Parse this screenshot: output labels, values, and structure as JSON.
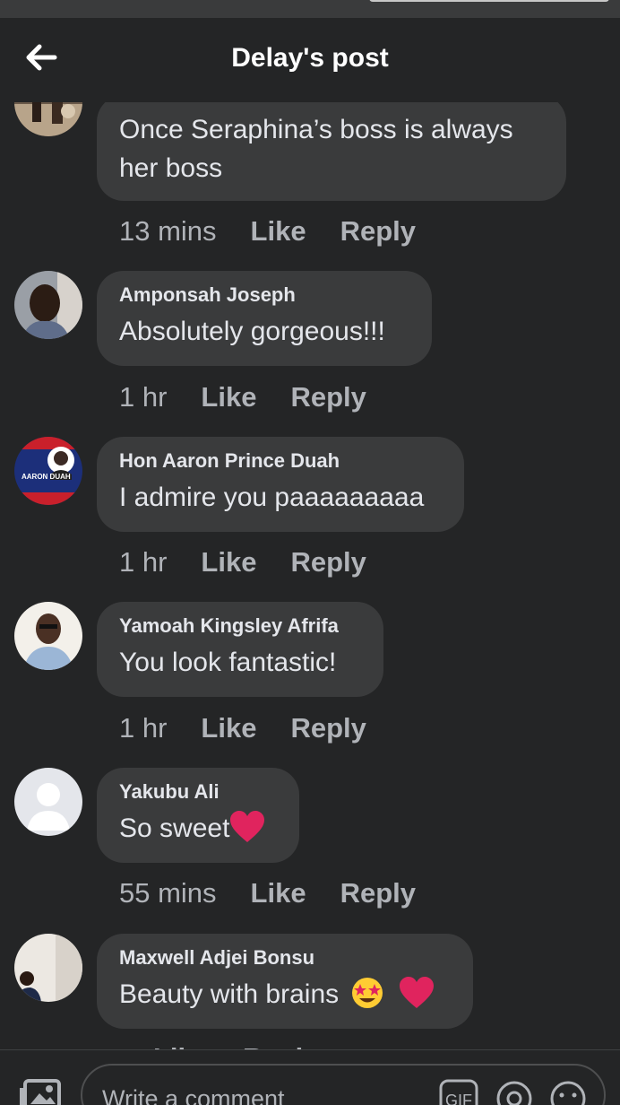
{
  "header": {
    "title": "Delay's post",
    "back_icon": "arrow-left-icon"
  },
  "comments": [
    {
      "author": "",
      "text": "Once Seraphina’s boss is always her boss",
      "text_line1": "Once Seraphina’s boss is always",
      "text_line2": "her boss",
      "time": "13 mins"
    },
    {
      "author": "Amponsah Joseph",
      "text": "Absolutely gorgeous!!!",
      "time": "1 hr"
    },
    {
      "author": "Hon Aaron Prince Duah",
      "text": "I admire you paaaaaaaaa",
      "time": "1 hr"
    },
    {
      "author": "Yamoah Kingsley Afrifa",
      "text": "You look fantastic!",
      "time": "1 hr"
    },
    {
      "author": "Yakubu Ali",
      "text": "So sweet",
      "time": "55 mins",
      "emoji": "red-heart"
    },
    {
      "author": "Maxwell Adjei Bonsu",
      "text": "Beauty with brains",
      "time": "",
      "emoji": "star-struck, red-heart"
    }
  ],
  "actions": {
    "like": "Like",
    "reply": "Reply"
  },
  "avatar_label": "AARON DUAH",
  "composer": {
    "placeholder": "Write a comment",
    "gif_label": "GIF"
  },
  "colors": {
    "background": "#242526",
    "bubble": "#3a3b3c",
    "text": "#e4e6eb",
    "muted": "#b0b3b8",
    "heart": "#e0245e"
  }
}
